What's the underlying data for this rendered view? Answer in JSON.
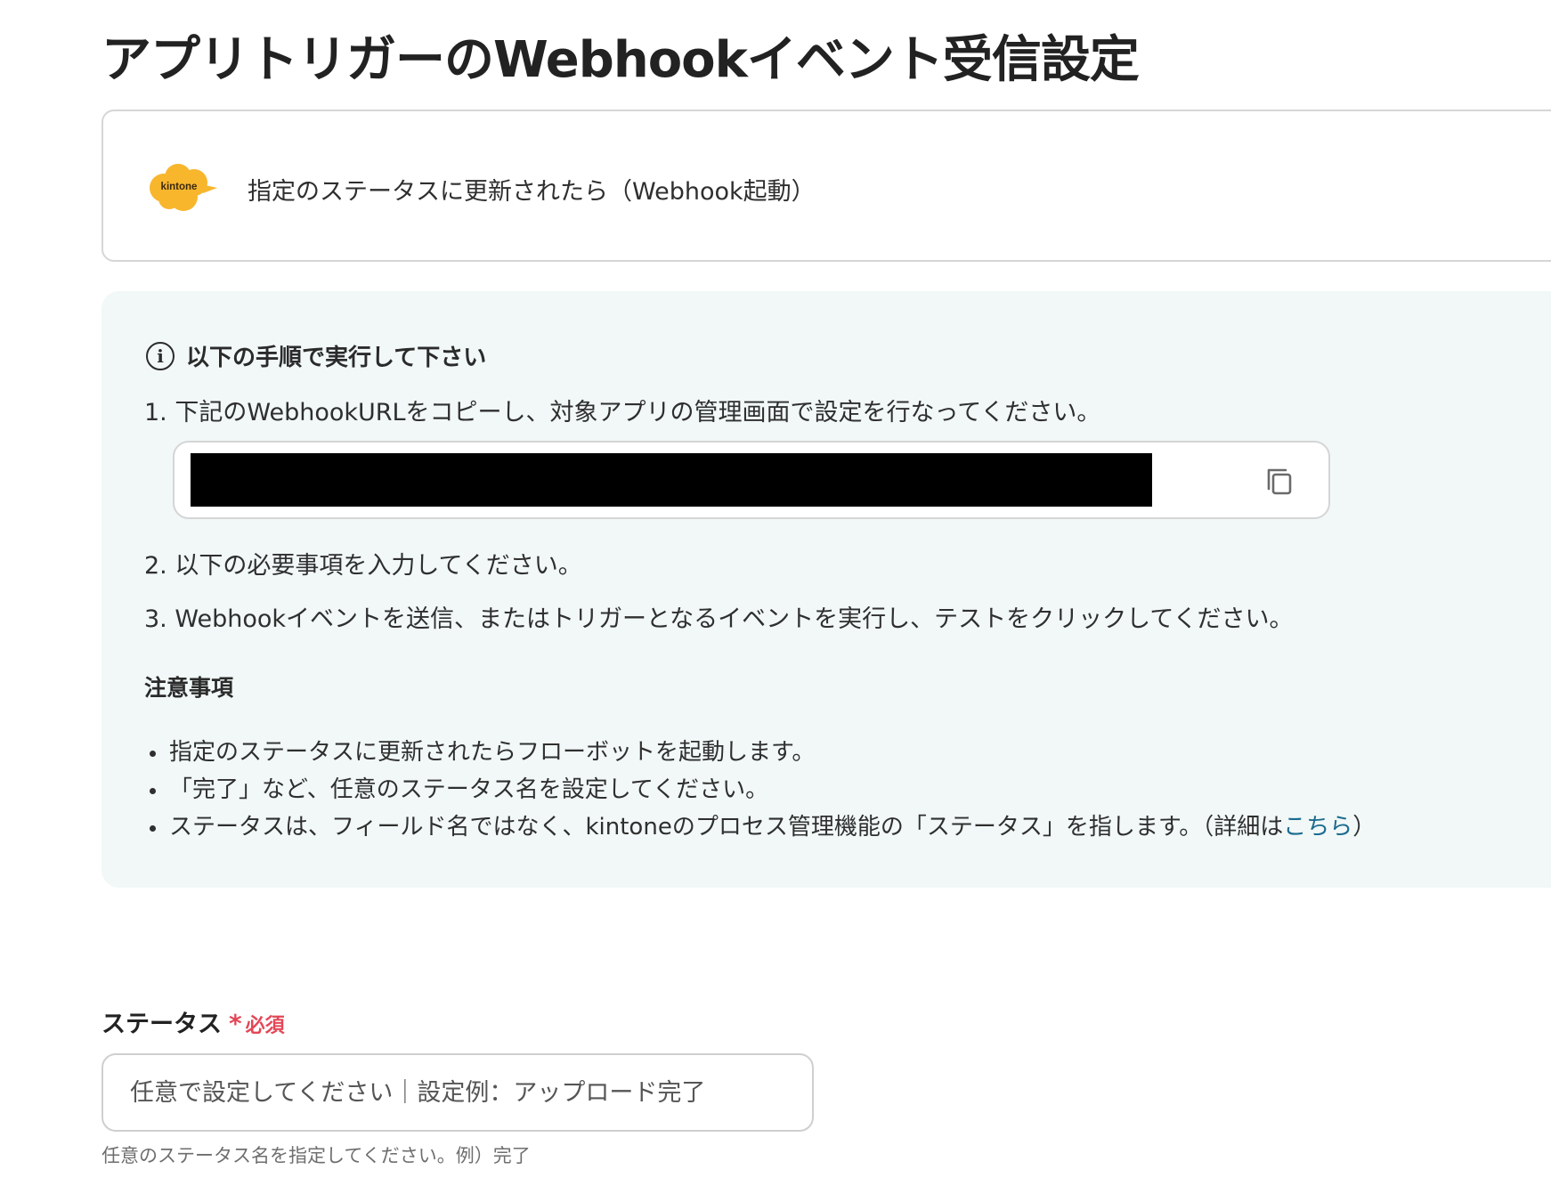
{
  "title": "アプリトリガーのWebhookイベント受信設定",
  "trigger": {
    "app_logo_text": "kintone",
    "logo_color": "#f8b62d",
    "label": "指定のステータスに更新されたら（Webhook起動）"
  },
  "instructions": {
    "icon": "info-icon",
    "heading": "以下の手順で実行して下さい",
    "steps": [
      "1. 下記のWebhookURLをコピーし、対象アプリの管理画面で設定を行なってください。",
      "2. 以下の必要事項を入力してください。",
      "3. Webhookイベントを送信、またはトリガーとなるイベントを実行し、テストをクリックしてください。"
    ],
    "copy_icon": "copy-icon",
    "background_color": "#f1f8f7"
  },
  "notes": {
    "title": "注意事項",
    "items": [
      "指定のステータスに更新されたらフローボットを起動します。",
      "「完了」など、任意のステータス名を設定してください。"
    ],
    "item3_text": "ステータスは、フィールド名ではなく、kintoneのプロセス管理機能の「ステータス」を指します。（詳細は",
    "item3_link": "こちら",
    "item3_end": "）",
    "link_color": "#1b6b8f"
  },
  "status_field": {
    "label": "ステータス",
    "required_mark": "*",
    "required_text": "必須",
    "required_color": "#e34757",
    "placeholder": "任意で設定してください｜設定例：アップロード完了",
    "value": "",
    "helper": "任意のステータス名を指定してください。例）完了"
  }
}
